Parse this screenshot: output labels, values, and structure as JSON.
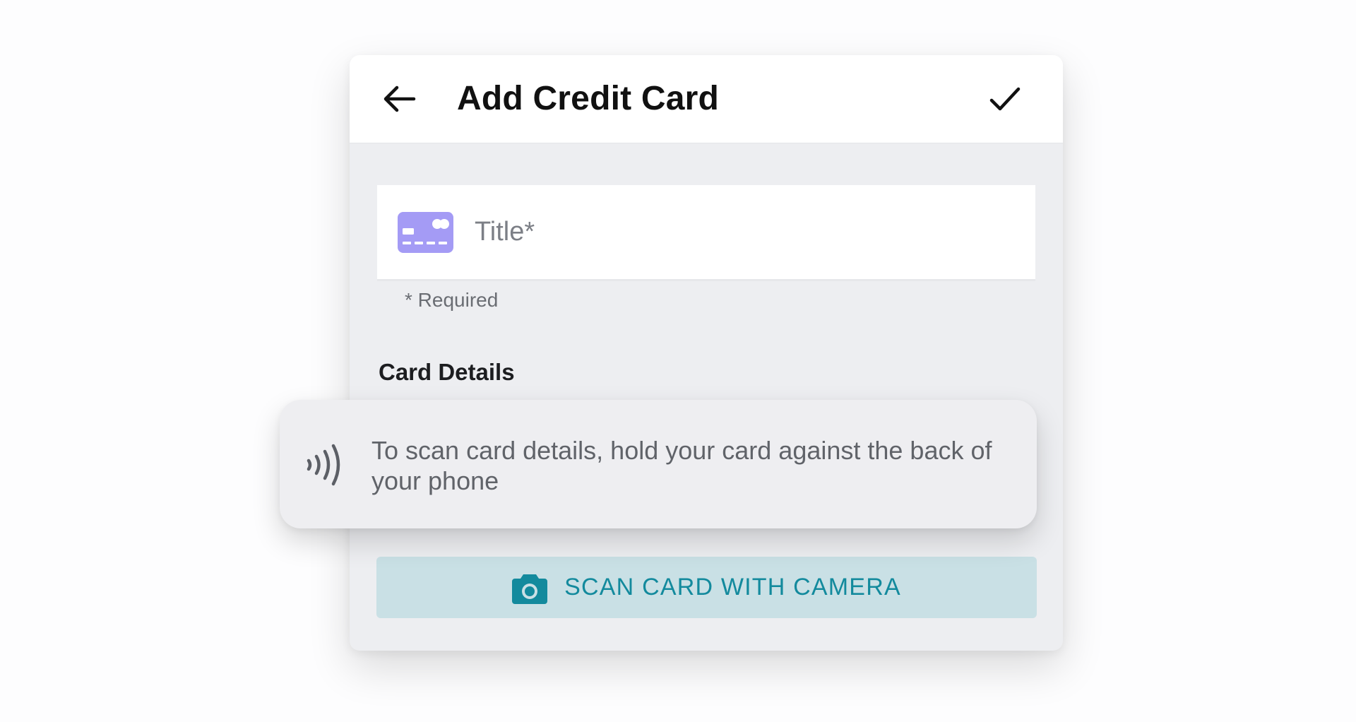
{
  "app_bar": {
    "title": "Add Credit Card",
    "back_icon": "arrow-left-icon",
    "confirm_icon": "check-icon"
  },
  "title_field": {
    "icon": "credit-card-icon",
    "placeholder": "Title*",
    "value": "",
    "icon_color": "#a49bf5"
  },
  "helper": {
    "text": "* Required"
  },
  "card_details": {
    "section_title": "Card Details"
  },
  "nfc_prompt": {
    "icon": "nfc-contactless-icon",
    "text": "To scan card details, hold your card against the back of your phone"
  },
  "scan_button": {
    "icon": "camera-icon",
    "label": "SCAN CARD WITH CAMERA",
    "accent_color": "#138a9d",
    "background_color": "#c9e0e5"
  }
}
